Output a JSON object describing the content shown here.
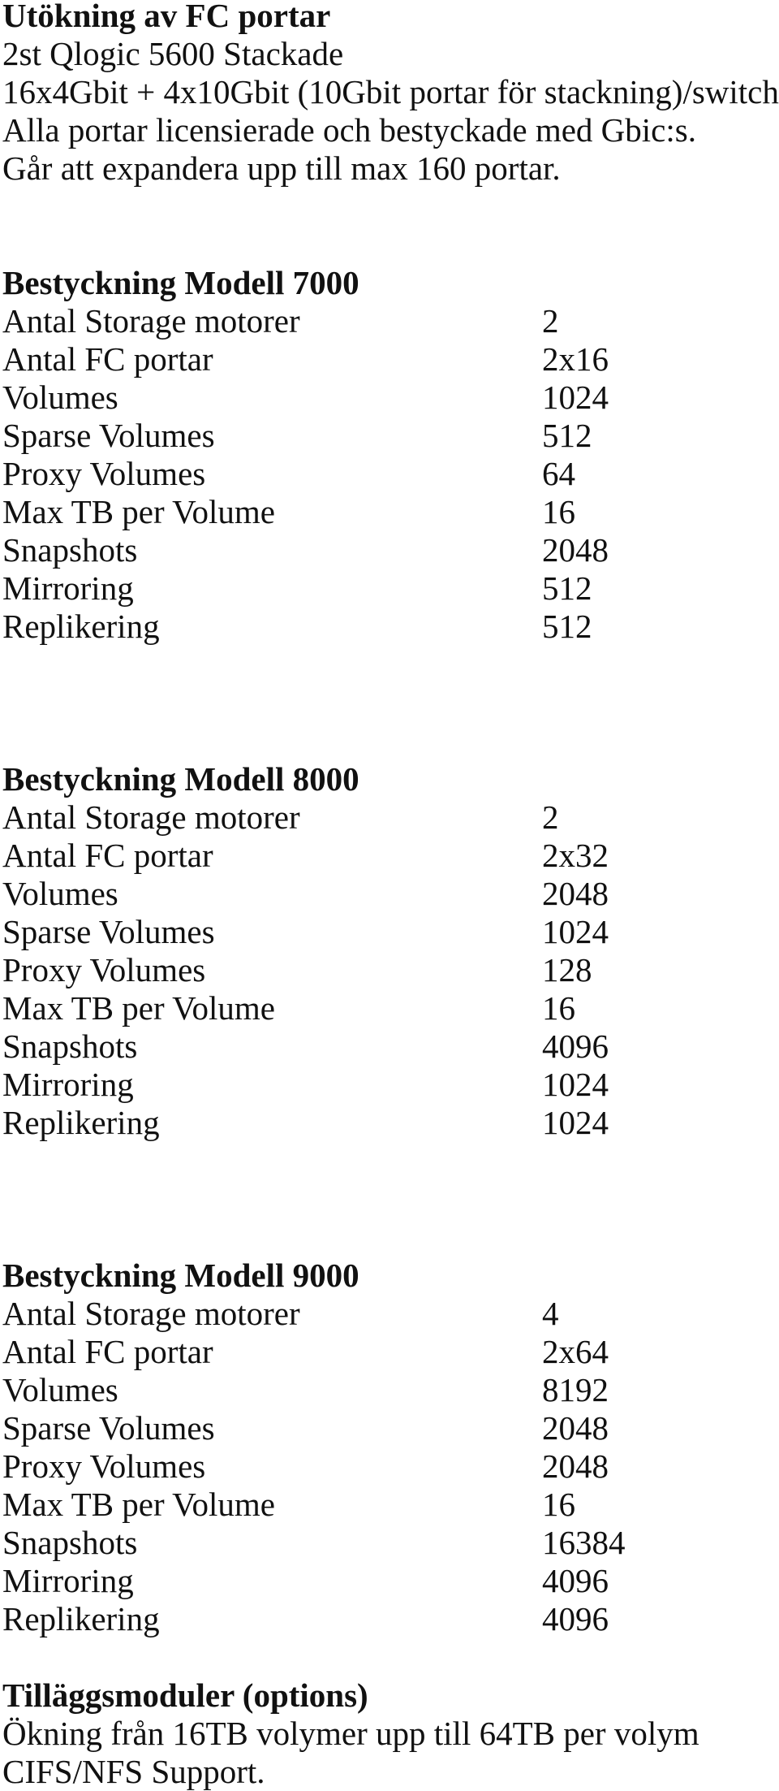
{
  "intro": {
    "title": "Utökning av FC portar",
    "lines": [
      "2st Qlogic 5600 Stackade",
      "16x4Gbit + 4x10Gbit (10Gbit portar för stackning)/switch",
      "Alla portar licensierade och bestyckade med Gbic:s.",
      "Går att expandera upp till max 160 portar."
    ]
  },
  "models": [
    {
      "title": "Bestyckning Modell 7000",
      "rows": [
        {
          "label": "Antal Storage motorer",
          "value": "2"
        },
        {
          "label": "Antal FC portar",
          "value": "2x16"
        },
        {
          "label": "Volumes",
          "value": "1024"
        },
        {
          "label": "Sparse Volumes",
          "value": "512"
        },
        {
          "label": "Proxy Volumes",
          "value": "64"
        },
        {
          "label": "Max TB per Volume",
          "value": "16"
        },
        {
          "label": "Snapshots",
          "value": "2048"
        },
        {
          "label": "Mirroring",
          "value": "512"
        },
        {
          "label": "Replikering",
          "value": "512"
        }
      ]
    },
    {
      "title": "Bestyckning Modell 8000",
      "rows": [
        {
          "label": "Antal Storage motorer",
          "value": "2"
        },
        {
          "label": "Antal FC portar",
          "value": "2x32"
        },
        {
          "label": "Volumes",
          "value": "2048"
        },
        {
          "label": "Sparse Volumes",
          "value": "1024"
        },
        {
          "label": "Proxy Volumes",
          "value": "128"
        },
        {
          "label": "Max TB per Volume",
          "value": "16"
        },
        {
          "label": "Snapshots",
          "value": "4096"
        },
        {
          "label": "Mirroring",
          "value": "1024"
        },
        {
          "label": "Replikering",
          "value": "1024"
        }
      ]
    },
    {
      "title": "Bestyckning Modell 9000",
      "rows": [
        {
          "label": "Antal Storage motorer",
          "value": "4"
        },
        {
          "label": "Antal FC portar",
          "value": "2x64"
        },
        {
          "label": "Volumes",
          "value": "8192"
        },
        {
          "label": "Sparse Volumes",
          "value": "2048"
        },
        {
          "label": "Proxy Volumes",
          "value": "2048"
        },
        {
          "label": "Max TB per Volume",
          "value": "16"
        },
        {
          "label": "Snapshots",
          "value": "16384"
        },
        {
          "label": "Mirroring",
          "value": "4096"
        },
        {
          "label": "Replikering",
          "value": "4096"
        }
      ]
    }
  ],
  "options": {
    "title": "Tilläggsmoduler (options)",
    "lines": [
      "Ökning från 16TB volymer upp till 64TB per volym",
      "CIFS/NFS Support."
    ]
  }
}
